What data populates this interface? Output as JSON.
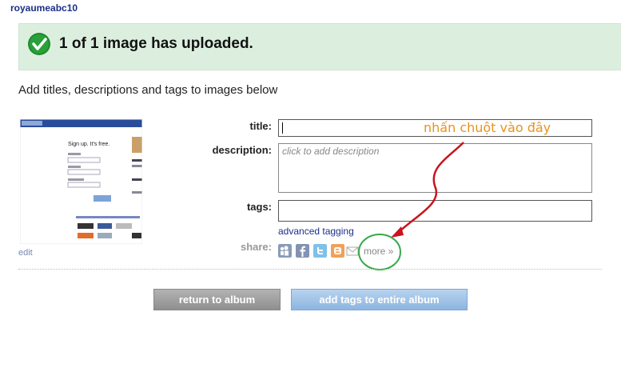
{
  "user": {
    "name": "royaumeabc10"
  },
  "banner": {
    "message": "1 of 1 image has uploaded."
  },
  "instructions": "Add titles, descriptions and tags to images below",
  "image": {
    "edit_label": "edit",
    "thumbnail": {
      "headline": "Sign up. It's free.",
      "site_label": "photobucket"
    }
  },
  "form": {
    "title_label": "title:",
    "title_value": "",
    "description_label": "description:",
    "description_placeholder": "click to add description",
    "tags_label": "tags:",
    "tags_value": "",
    "advanced_tagging_label": "advanced tagging",
    "share_label": "share:",
    "share_icons": [
      "myspace-icon",
      "facebook-icon",
      "twitter-icon",
      "blogger-icon",
      "email-icon"
    ],
    "more_label": "more »"
  },
  "annotation": {
    "text": "nhấn chuột vào đây",
    "color": "#e8931d"
  },
  "buttons": {
    "return_label": "return to album",
    "add_tags_label": "add tags to entire album"
  },
  "colors": {
    "banner_bg": "#dcefdf",
    "check_green": "#1e8a2e",
    "arrow_red": "#c8141e",
    "circle_green": "#3aa94a"
  }
}
